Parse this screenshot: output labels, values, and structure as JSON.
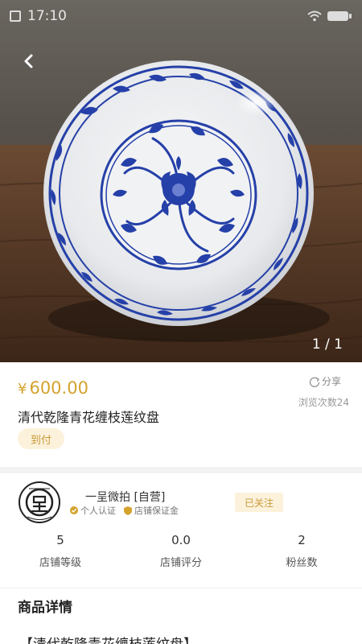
{
  "status_bar": {
    "time": "17:10"
  },
  "gallery": {
    "counter": "1 / 1"
  },
  "product": {
    "currency": "¥",
    "price": "600.00",
    "title": "清代乾隆青花缠枝莲纹盘",
    "tag": "到付",
    "share_label": "分享",
    "views": "浏览次数24"
  },
  "shop": {
    "name": "一呈微拍 [自营]",
    "badge_personal": "个人认证",
    "badge_deposit": "店铺保证金",
    "follow_label": "已关注",
    "stats": [
      {
        "value": "5",
        "label": "店铺等级"
      },
      {
        "value": "0.0",
        "label": "店铺评分"
      },
      {
        "value": "2",
        "label": "粉丝数"
      }
    ]
  },
  "detail": {
    "heading": "商品详情",
    "first_line": "【清代乾隆青花缠枝莲纹盘】"
  },
  "colors": {
    "accent": "#d4a32e",
    "tag_bg": "#fcf2dc",
    "porcelain_blue": "#1f3aa8"
  }
}
